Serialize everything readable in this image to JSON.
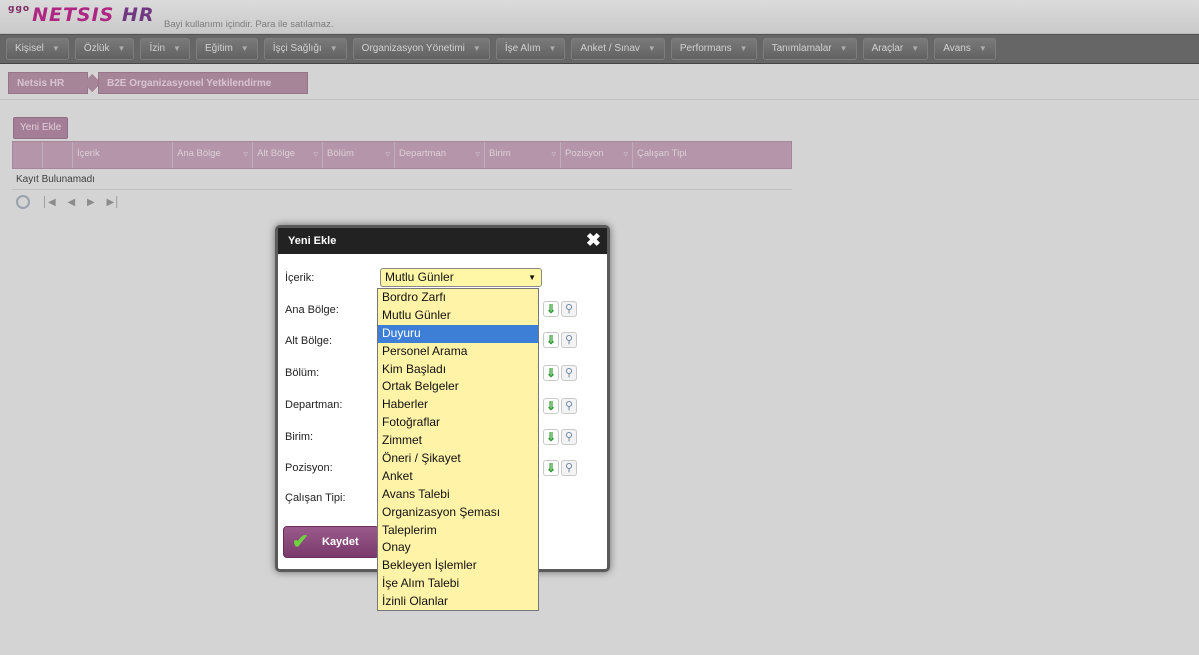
{
  "header": {
    "logo_prefix": "ggo",
    "logo_name": "NETSIS",
    "logo_suffix": "HR",
    "note": "Bayi kullanımı içindir. Para ile satılamaz."
  },
  "menu": [
    {
      "label": "Kişisel"
    },
    {
      "label": "Özlük"
    },
    {
      "label": "İzin"
    },
    {
      "label": "Eğitim"
    },
    {
      "label": "İşçi Sağlığı"
    },
    {
      "label": "Organizasyon Yönetimi"
    },
    {
      "label": "İşe Alım"
    },
    {
      "label": "Anket / Sınav"
    },
    {
      "label": "Performans"
    },
    {
      "label": "Tanımlamalar"
    },
    {
      "label": "Araçlar"
    },
    {
      "label": "Avans"
    }
  ],
  "breadcrumb": {
    "root": "Netsis HR",
    "current": "B2E Organizasyonel Yetkilendirme"
  },
  "grid": {
    "add_label": "Yeni Ekle",
    "columns": [
      "İçerik",
      "Ana Bölge",
      "Alt Bölge",
      "Bölüm",
      "Departman",
      "Birim",
      "Pozisyon",
      "Çalışan Tipi"
    ],
    "empty_text": "Kayıt Bulunamadı"
  },
  "modal": {
    "title": "Yeni Ekle",
    "labels": {
      "icerik": "İçerik:",
      "ana_bolge": "Ana Bölge:",
      "alt_bolge": "Alt Bölge:",
      "bolum": "Bölüm:",
      "departman": "Departman:",
      "birim": "Birim:",
      "pozisyon": "Pozisyon:",
      "calisan_tipi": "Çalışan Tipi:"
    },
    "selected_value": "Mutlu Günler",
    "save_label": "Kaydet"
  },
  "dropdown": {
    "highlighted_index": 2,
    "options": [
      "Bordro Zarfı",
      "Mutlu Günler",
      "Duyuru",
      "Personel Arama",
      "Kim Başladı",
      "Ortak Belgeler",
      "Haberler",
      "Fotoğraflar",
      "Zimmet",
      "Öneri / Şikayet",
      "Anket",
      "Avans Talebi",
      "Organizasyon Şeması",
      "Taleplerim",
      "Onay",
      "Bekleyen İşlemler",
      "İşe Alım Talebi",
      "İzinli Olanlar"
    ]
  }
}
